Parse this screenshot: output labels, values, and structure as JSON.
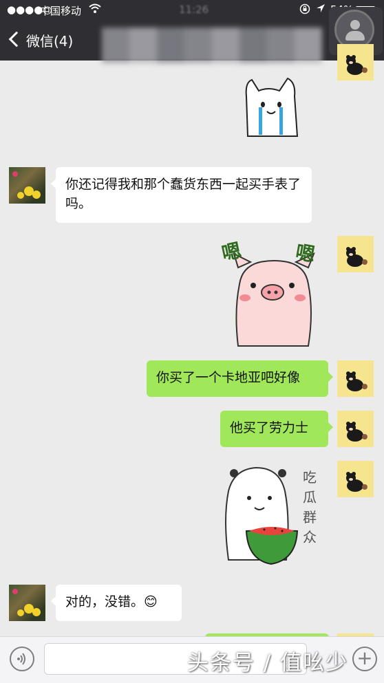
{
  "status_bar": {
    "signal": "●●●●○",
    "carrier": "中国移动",
    "time": "11:26",
    "battery": "54%",
    "battery_level": 0.54
  },
  "nav": {
    "back_label": "微信(4)"
  },
  "messages": [
    {
      "from": "other",
      "text": "你还记得我和那个蠢货东西一起买手表了吗。"
    },
    {
      "from": "me",
      "type": "sticker",
      "sticker_text": "嗯嗯"
    },
    {
      "from": "me",
      "text": "你买了一个卡地亚吧好像"
    },
    {
      "from": "me",
      "text": "他买了劳力士"
    },
    {
      "from": "me",
      "type": "sticker",
      "sticker_text": "吃瓜群众"
    },
    {
      "from": "other",
      "text": "对的，没错。",
      "emoji": "😊"
    }
  ],
  "watermark": "头条号 / 值吆少",
  "colors": {
    "me_bubble": "#a0e75a",
    "other_bubble": "#ffffff",
    "chat_bg": "#ebebeb",
    "nav_bg": "#2e2e33"
  }
}
